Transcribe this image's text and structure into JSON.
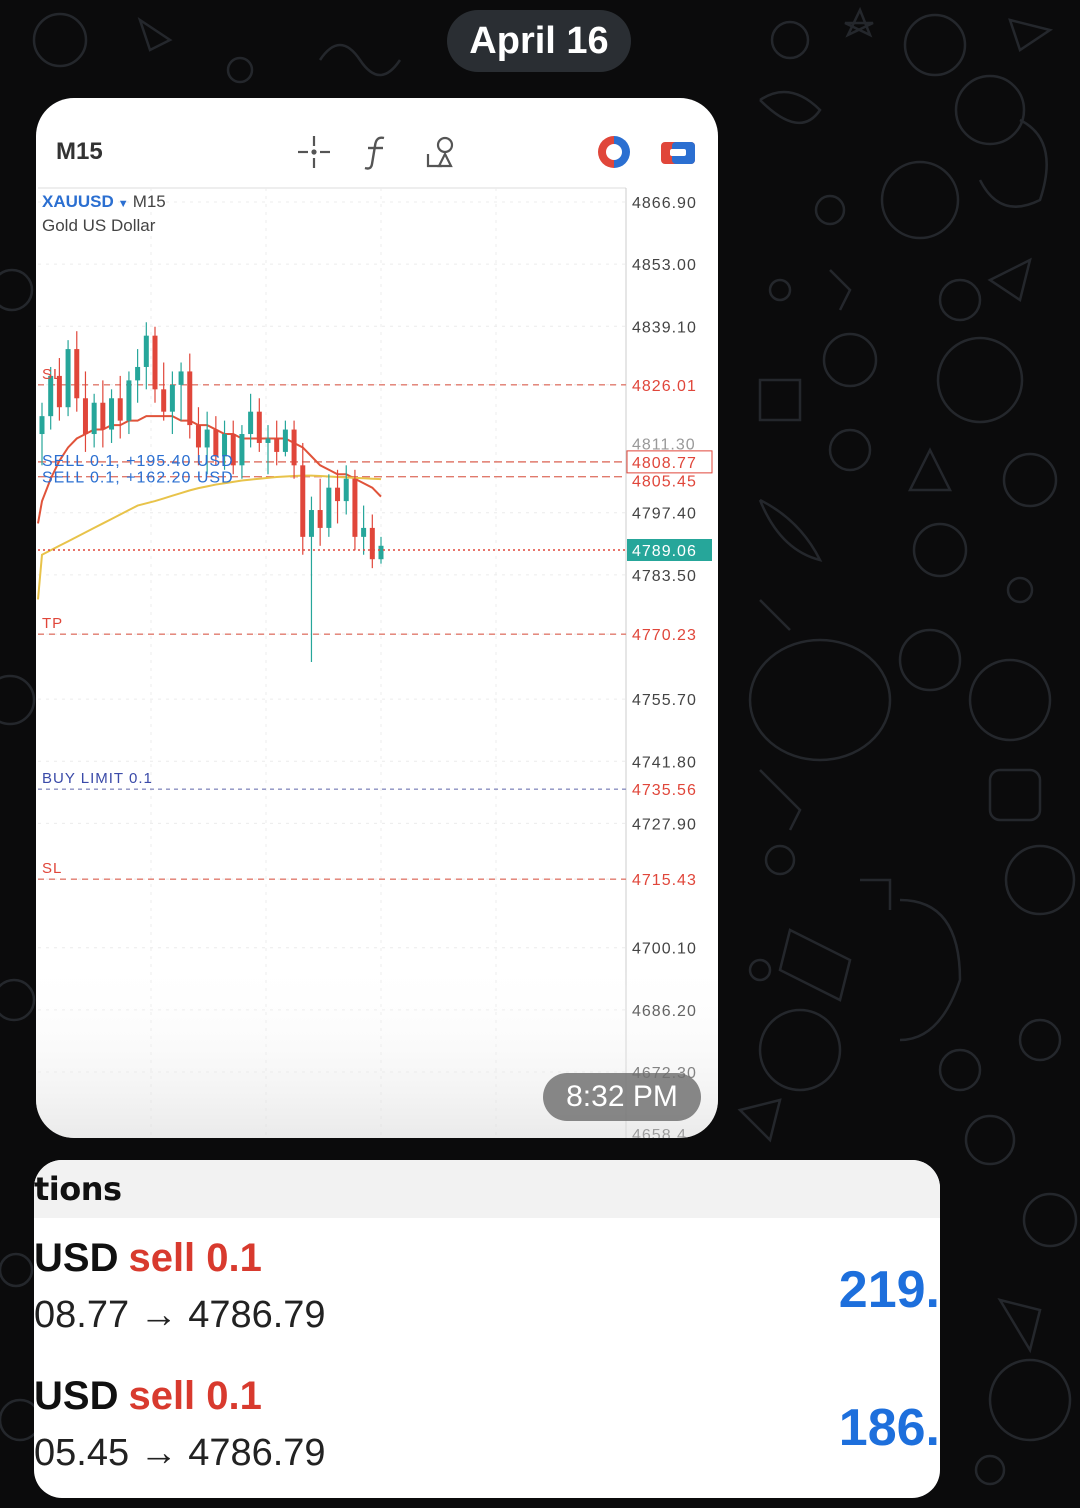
{
  "date_pill": "April 16",
  "message_time": "8:32 PM",
  "chart_screenshot": {
    "timeframe": "M15",
    "symbol": "XAUUSD",
    "symbol_timeframe": "M15",
    "symbol_description": "Gold US Dollar",
    "toolbar_icons": [
      "crosshair-icon",
      "indicator-f-icon",
      "objects-icon",
      "one-click-trading-icon",
      "trade-icon"
    ]
  },
  "chart_data": {
    "type": "candlestick",
    "symbol": "XAUUSD",
    "timeframe": "M15",
    "price_axis_ticks": [
      "4866.90",
      "4853.00",
      "4839.10",
      "4826.01",
      "4811.30",
      "4808.77",
      "4805.45",
      "4797.40",
      "4789.06",
      "4783.50",
      "4770.23",
      "4755.70",
      "4741.80",
      "4735.56",
      "4727.90",
      "4715.43",
      "4700.10",
      "4686.20",
      "4672.30",
      "4658.4"
    ],
    "ylim": [
      4658.4,
      4870.0
    ],
    "current_price": "4789.06",
    "order_levels": [
      {
        "label": "SELL 0.1, +195.40 USD",
        "price": "4808.77"
      },
      {
        "label": "SELL 0.1, +162.20 USD",
        "price": "4805.45"
      },
      {
        "label": "SL",
        "price": "4826.01"
      },
      {
        "label": "TP",
        "price": "4770.23"
      },
      {
        "label": "BUY LIMIT 0.1",
        "price": "4735.56"
      },
      {
        "label": "SL",
        "price": "4715.43"
      }
    ],
    "candles": [
      [
        4815,
        4822,
        4808,
        4819
      ],
      [
        4819,
        4830,
        4816,
        4828
      ],
      [
        4828,
        4832,
        4818,
        4821
      ],
      [
        4821,
        4836,
        4819,
        4834
      ],
      [
        4834,
        4838,
        4820,
        4823
      ],
      [
        4823,
        4829,
        4811,
        4815
      ],
      [
        4815,
        4824,
        4812,
        4822
      ],
      [
        4822,
        4827,
        4812,
        4816
      ],
      [
        4816,
        4825,
        4813,
        4823
      ],
      [
        4823,
        4828,
        4814,
        4818
      ],
      [
        4818,
        4829,
        4815,
        4827
      ],
      [
        4827,
        4834,
        4822,
        4830
      ],
      [
        4830,
        4840,
        4825,
        4837
      ],
      [
        4837,
        4839,
        4822,
        4825
      ],
      [
        4825,
        4831,
        4818,
        4820
      ],
      [
        4820,
        4829,
        4815,
        4826
      ],
      [
        4826,
        4831,
        4818,
        4829
      ],
      [
        4829,
        4833,
        4814,
        4817
      ],
      [
        4817,
        4821,
        4808,
        4812
      ],
      [
        4812,
        4820,
        4806,
        4816
      ],
      [
        4816,
        4819,
        4808,
        4810
      ],
      [
        4810,
        4818,
        4807,
        4815
      ],
      [
        4815,
        4818,
        4806,
        4808
      ],
      [
        4808,
        4817,
        4805,
        4815
      ],
      [
        4815,
        4824,
        4812,
        4820
      ],
      [
        4820,
        4823,
        4811,
        4813
      ],
      [
        4813,
        4817,
        4806,
        4814
      ],
      [
        4814,
        4818,
        4808,
        4811
      ],
      [
        4811,
        4818,
        4810,
        4816
      ],
      [
        4816,
        4818,
        4805,
        4808
      ],
      [
        4808,
        4813,
        4788,
        4792
      ],
      [
        4792,
        4801,
        4764,
        4798
      ],
      [
        4798,
        4805,
        4790,
        4794
      ],
      [
        4794,
        4806,
        4792,
        4803
      ],
      [
        4803,
        4807,
        4795,
        4800
      ],
      [
        4800,
        4808,
        4797,
        4805
      ],
      [
        4805,
        4807,
        4789,
        4792
      ],
      [
        4792,
        4799,
        4788,
        4794
      ],
      [
        4794,
        4797,
        4785,
        4787
      ],
      [
        4787,
        4792,
        4786,
        4790
      ]
    ],
    "moving_averages": [
      {
        "color": "#e0533a",
        "values": [
          4800,
          4805,
          4809,
          4812,
          4814,
          4815,
          4816,
          4816,
          4817,
          4817,
          4818,
          4818,
          4819,
          4819,
          4819,
          4819,
          4818,
          4818,
          4817,
          4817,
          4816,
          4815,
          4815,
          4814,
          4814,
          4814,
          4814,
          4814,
          4814,
          4813,
          4812,
          4810,
          4808,
          4807,
          4806,
          4806,
          4805,
          4804,
          4803,
          4801
        ]
      },
      {
        "color": "#e8c34a",
        "values": [
          4788,
          4789,
          4790,
          4791,
          4792,
          4793,
          4794,
          4795,
          4796,
          4797,
          4798,
          4799,
          4799.5,
          4800,
          4800.6,
          4801.2,
          4801.8,
          4802.4,
          4802.9,
          4803.3,
          4803.7,
          4804.0,
          4804.3,
          4804.6,
          4804.8,
          4805.0,
          4805.2,
          4805.4,
          4805.5,
          4805.6,
          4805.7,
          4805.7,
          4805.6,
          4805.5,
          4805.4,
          4805.3,
          4805.2,
          4805.1,
          4805.0,
          4804.9
        ]
      }
    ],
    "colors": {
      "bull": "#26a69a",
      "bear": "#e0463a"
    }
  },
  "positions_panel": {
    "header_partial": "tions",
    "rows": [
      {
        "symbol_partial": "USD",
        "side": "sell 0.1",
        "prices": "08.77 → 4786.79",
        "profit_partial": "219."
      },
      {
        "symbol_partial": "USD",
        "side": "sell 0.1",
        "prices": "05.45 → 4786.79",
        "profit_partial": "186."
      }
    ]
  }
}
